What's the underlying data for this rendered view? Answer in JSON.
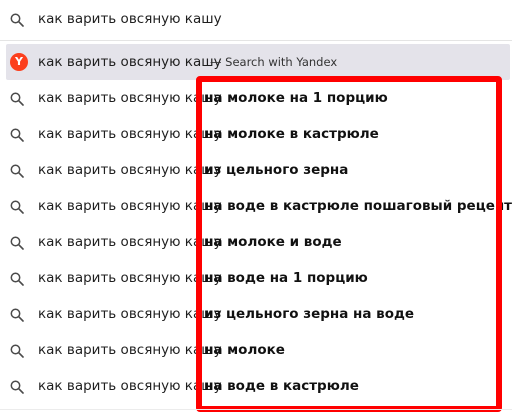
{
  "search_bar": {
    "query": "как варить овсяную кашу",
    "icon": "search-icon"
  },
  "suggestions": [
    {
      "base": "как варить овсяную кашу",
      "engine_label": "— Search with Yandex",
      "icon": "yandex-icon",
      "badge_letter": "Y"
    },
    {
      "base": "как варить овсяную кашу",
      "suffix": "на молоке на 1 порцию",
      "icon": "search-icon"
    },
    {
      "base": "как варить овсяную кашу",
      "suffix": "на молоке в кастрюле",
      "icon": "search-icon"
    },
    {
      "base": "как варить овсяную кашу",
      "suffix": "из цельного зерна",
      "icon": "search-icon"
    },
    {
      "base": "как варить овсяную кашу",
      "suffix": "на воде в кастрюле пошаговый рецепт",
      "icon": "search-icon"
    },
    {
      "base": "как варить овсяную кашу",
      "suffix": "на молоке и воде",
      "icon": "search-icon"
    },
    {
      "base": "как варить овсяную кашу",
      "suffix": "на воде на 1 порцию",
      "icon": "search-icon"
    },
    {
      "base": "как варить овсяную кашу",
      "suffix": "из цельного зерна на воде",
      "icon": "search-icon"
    },
    {
      "base": "как варить овсяную кашу",
      "suffix": "на молоке",
      "icon": "search-icon"
    },
    {
      "base": "как варить овсяную кашу",
      "suffix": "на воде в кастрюле",
      "icon": "search-icon"
    }
  ],
  "colors": {
    "highlight_border": "#ff0000",
    "selected_row": "#e4e3ea",
    "yandex_brand": "#fc3f1d"
  }
}
